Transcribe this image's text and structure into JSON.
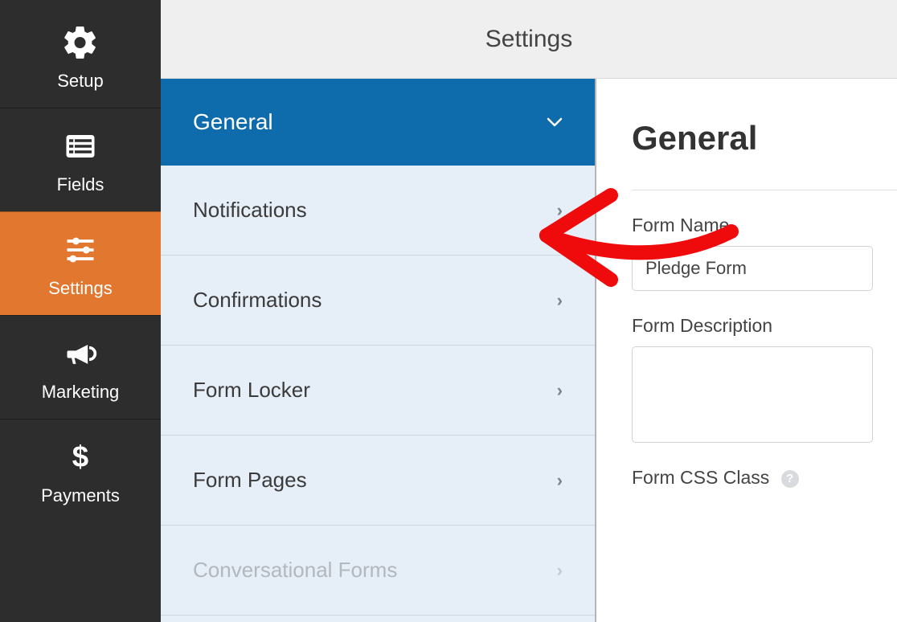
{
  "header": {
    "title": "Settings"
  },
  "sidebar": {
    "items": [
      {
        "label": "Setup"
      },
      {
        "label": "Fields"
      },
      {
        "label": "Settings"
      },
      {
        "label": "Marketing"
      },
      {
        "label": "Payments"
      }
    ]
  },
  "settings_list": {
    "items": [
      {
        "label": "General"
      },
      {
        "label": "Notifications"
      },
      {
        "label": "Confirmations"
      },
      {
        "label": "Form Locker"
      },
      {
        "label": "Form Pages"
      },
      {
        "label": "Conversational Forms"
      }
    ]
  },
  "content": {
    "heading": "General",
    "form_name_label": "Form Name",
    "form_name_value": "Pledge Form",
    "form_description_label": "Form Description",
    "form_description_value": "",
    "form_css_label": "Form CSS Class"
  }
}
